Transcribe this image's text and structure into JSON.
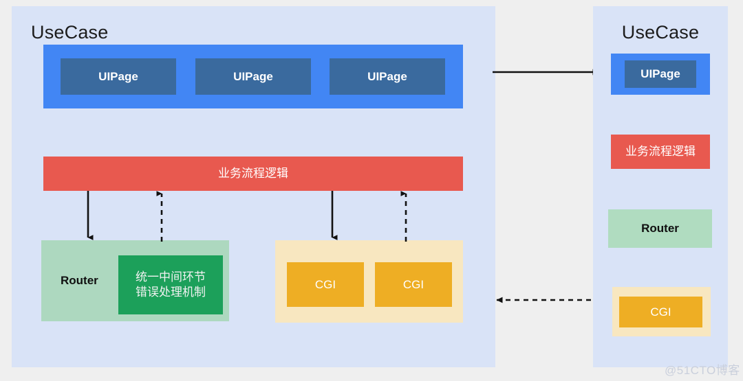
{
  "diagram": {
    "background_color": "#efefef",
    "panel_color": "#d9e3f7"
  },
  "left_panel": {
    "title": "UseCase",
    "ui_layer": {
      "container_color": "#4286f4",
      "pages": [
        {
          "label": "UIPage"
        },
        {
          "label": "UIPage"
        },
        {
          "label": "UIPage"
        }
      ]
    },
    "business_logic": {
      "label": "业务流程逻辑",
      "color": "#e8594f"
    },
    "router_group": {
      "label": "Router",
      "color": "#add8bf",
      "inner": {
        "label": "统一中间环节\n错误处理机制",
        "color": "#1ca05a"
      }
    },
    "cgi_group": {
      "color": "#f8e7c0",
      "items": [
        {
          "label": "CGI"
        },
        {
          "label": "CGI"
        }
      ]
    }
  },
  "right_panel": {
    "title": "UseCase",
    "ui_layer": {
      "container_color": "#4286f4",
      "page": {
        "label": "UIPage"
      }
    },
    "business_logic": {
      "label": "业务流程逻辑",
      "color": "#e8594f"
    },
    "router": {
      "label": "Router",
      "color": "#b0dcc0"
    },
    "cgi_group": {
      "color": "#f8e7c0",
      "item": {
        "label": "CGI"
      }
    }
  },
  "connectors": {
    "top": {
      "style": "solid",
      "direction": "right"
    },
    "bottom": {
      "style": "dashed",
      "direction": "left"
    },
    "logic_to_router": {
      "style": "solid",
      "direction": "down"
    },
    "router_to_logic": {
      "style": "dashed",
      "direction": "up"
    },
    "logic_to_cgi": {
      "style": "solid",
      "direction": "down"
    },
    "cgi_to_logic": {
      "style": "dashed",
      "direction": "up"
    }
  },
  "watermark": {
    "text": "@51CTO博客"
  }
}
